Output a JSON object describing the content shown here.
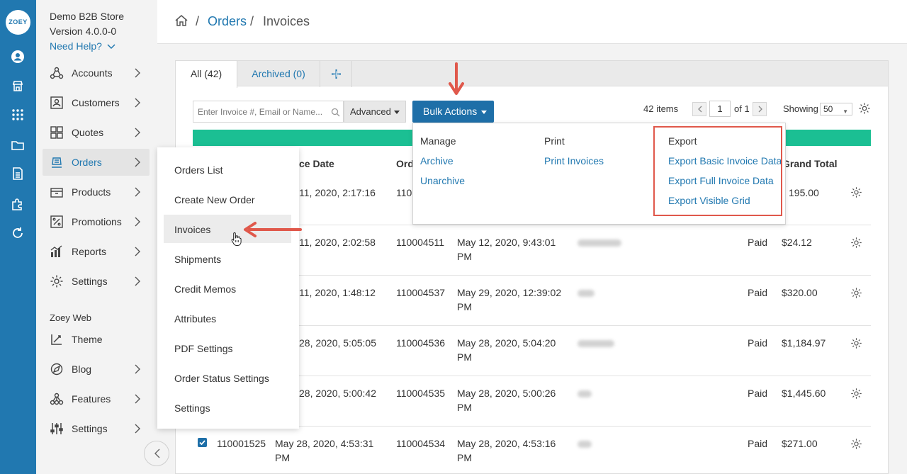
{
  "app": {
    "logo_text": "ZOEY",
    "store_name": "Demo B2B Store",
    "version": "Version 4.0.0-0",
    "need_help": "Need Help?"
  },
  "rail_icons": [
    "account-circle-icon",
    "store-icon",
    "apps-grid-icon",
    "folder-icon",
    "document-icon",
    "puzzle-icon",
    "refresh-icon"
  ],
  "sidebar": {
    "items": [
      {
        "label": "Accounts",
        "icon": "accounts-icon"
      },
      {
        "label": "Customers",
        "icon": "customers-icon"
      },
      {
        "label": "Quotes",
        "icon": "quotes-icon"
      },
      {
        "label": "Orders",
        "icon": "orders-icon",
        "active": true
      },
      {
        "label": "Products",
        "icon": "products-icon"
      },
      {
        "label": "Promotions",
        "icon": "promotions-icon"
      },
      {
        "label": "Reports",
        "icon": "reports-icon"
      },
      {
        "label": "Settings",
        "icon": "gear-icon"
      }
    ],
    "section_label": "Zoey Web",
    "web_items": [
      {
        "label": "Theme",
        "icon": "theme-icon"
      },
      {
        "label": "Blog",
        "icon": "blog-icon"
      },
      {
        "label": "Features",
        "icon": "features-icon"
      },
      {
        "label": "Settings",
        "icon": "sliders-icon"
      }
    ]
  },
  "breadcrumb": {
    "sep": "/",
    "parent": "Orders",
    "current": "Invoices"
  },
  "tabs": [
    {
      "label": "All (42)",
      "active": true
    },
    {
      "label": "Archived (0)",
      "active": false
    }
  ],
  "toolbar": {
    "search_placeholder": "Enter Invoice #, Email or Name...",
    "advanced_label": "Advanced",
    "bulk_label": "Bulk Actions",
    "items_count": "42 items",
    "page_value": "1",
    "page_of": "of 1",
    "showing_label": "Showing",
    "per_page": "50"
  },
  "table": {
    "headers": {
      "invoice_date": "ce Date",
      "order": "Ord",
      "grand_total": "Grand Total"
    },
    "rows": [
      {
        "invoice": "",
        "invoice_date": "11, 2020, 2:17:16",
        "order": "110",
        "order_date_1": "",
        "order_date_2": "",
        "status": "",
        "total": "195.00"
      },
      {
        "invoice": "",
        "invoice_date": "11, 2020, 2:02:58",
        "order": "110004511",
        "order_date_1": "May 12, 2020, 9:43:01",
        "order_date_2": "PM",
        "status": "Paid",
        "total": "$24.12"
      },
      {
        "invoice": "",
        "invoice_date": "11, 2020, 1:48:12",
        "order": "110004537",
        "order_date_1": "May 29, 2020, 12:39:02",
        "order_date_2": "PM",
        "status": "Paid",
        "total": "$320.00"
      },
      {
        "invoice": "",
        "invoice_date": "28, 2020, 5:05:05",
        "order": "110004536",
        "order_date_1": "May 28, 2020, 5:04:20",
        "order_date_2": "PM",
        "status": "Paid",
        "total": "$1,184.97"
      },
      {
        "invoice": "",
        "invoice_date": "28, 2020, 5:00:42",
        "order": "110004535",
        "order_date_1": "May 28, 2020, 5:00:26",
        "order_date_2": "PM",
        "status": "Paid",
        "total": "$1,445.60"
      },
      {
        "invoice": "110001525",
        "invoice_date": "May 28, 2020, 4:53:31",
        "invoice_date_2": "PM",
        "order": "110004534",
        "order_date_1": "May 28, 2020, 4:53:16",
        "order_date_2": "PM",
        "status": "Paid",
        "total": "$271.00"
      }
    ]
  },
  "orders_menu": [
    "Orders List",
    "Create New Order",
    "Invoices",
    "Shipments",
    "Credit Memos",
    "Attributes",
    "PDF Settings",
    "Order Status Settings",
    "Settings"
  ],
  "bulk_menu": {
    "manage": {
      "heading": "Manage",
      "items": [
        "Archive",
        "Unarchive"
      ]
    },
    "print": {
      "heading": "Print",
      "items": [
        "Print Invoices"
      ]
    },
    "export": {
      "heading": "Export",
      "items": [
        "Export Basic Invoice Data",
        "Export Full Invoice Data",
        "Export Visible Grid"
      ]
    }
  },
  "colors": {
    "rail": "#2178b0",
    "accent": "#1e6fa8",
    "green_bar": "#1bbf93",
    "annotation": "#e0584b",
    "link": "#2178b0"
  }
}
